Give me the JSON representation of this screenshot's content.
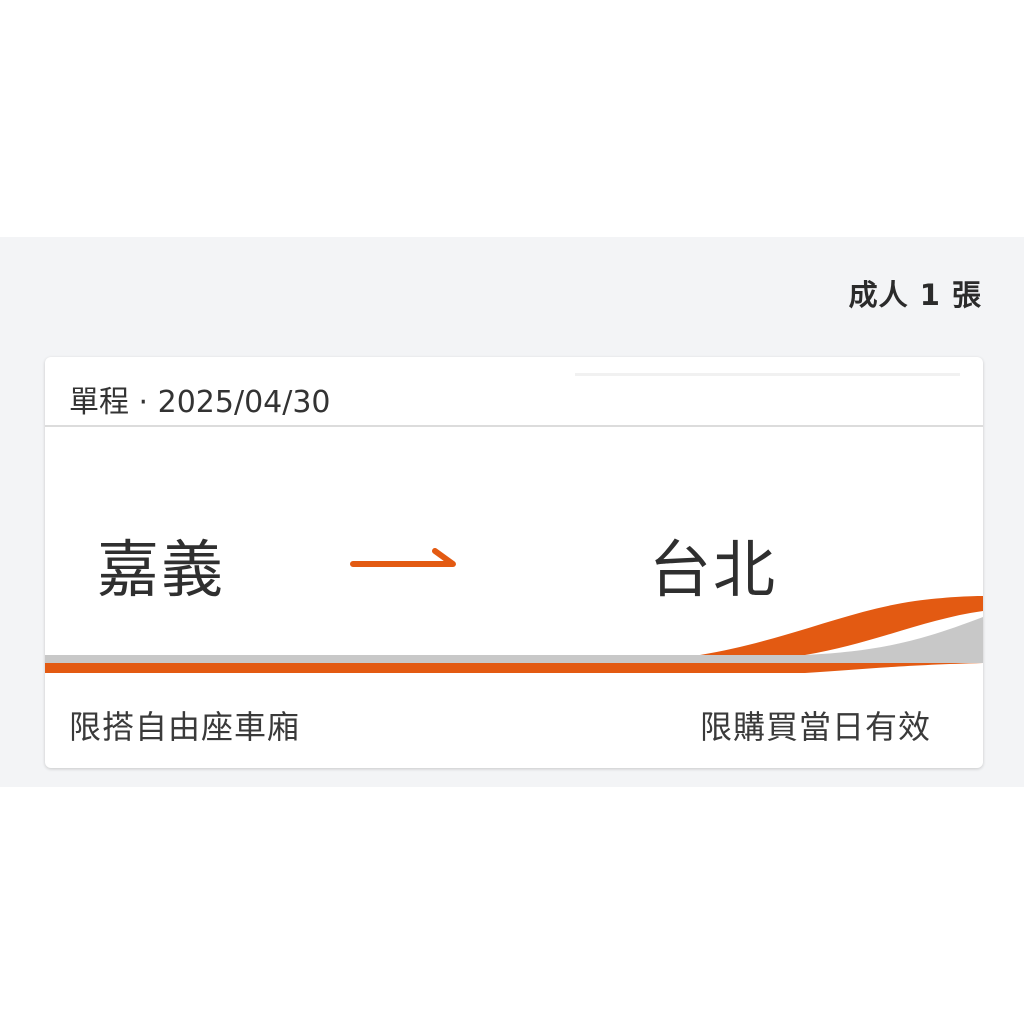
{
  "passenger": {
    "summary": "成人 1 張"
  },
  "ticket": {
    "trip": "單程 · 2025/04/30",
    "origin": "嘉義",
    "destination": "台北",
    "seat_notice": "限搭自由座車廂",
    "validity_notice": "限購買當日有效"
  },
  "colors": {
    "accent": "#e35a12",
    "stripe_gray": "#c8c8c8",
    "background": "#f3f4f6"
  }
}
